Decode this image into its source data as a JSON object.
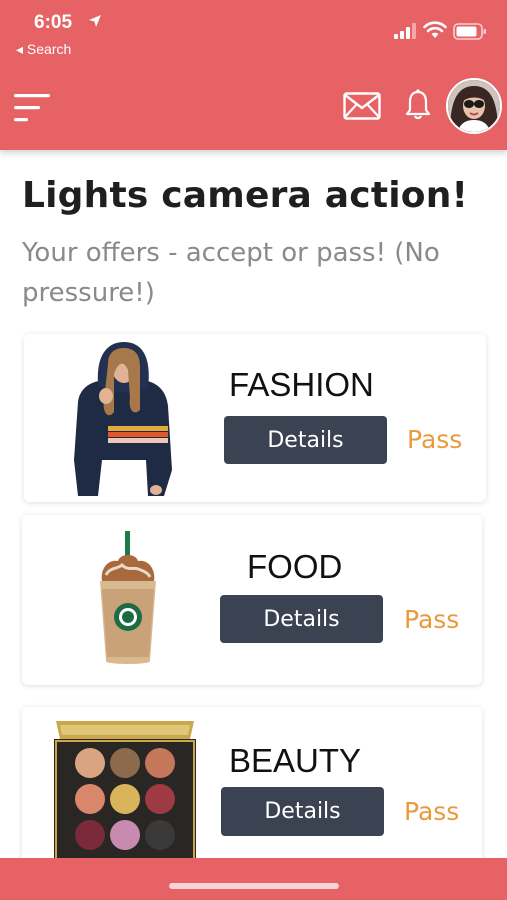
{
  "status_bar": {
    "time": "6:05",
    "back_label": "◂ Search"
  },
  "header": {
    "menu_icon": "menu-icon",
    "mail_icon": "mail-icon",
    "bell_icon": "bell-icon",
    "avatar": "avatar",
    "color": "#e66265"
  },
  "page": {
    "title": "Lights camera action!",
    "subtitle": "Your offers - accept or pass! (No pressure!)"
  },
  "offers": [
    {
      "category": "FASHION",
      "details_label": "Details",
      "pass_label": "Pass"
    },
    {
      "category": "FOOD",
      "details_label": "Details",
      "pass_label": "Pass"
    },
    {
      "category": "BEAUTY",
      "details_label": "Details",
      "pass_label": "Pass"
    }
  ],
  "colors": {
    "brand": "#e66265",
    "button": "#3b4252",
    "pass": "#e99a3c"
  }
}
